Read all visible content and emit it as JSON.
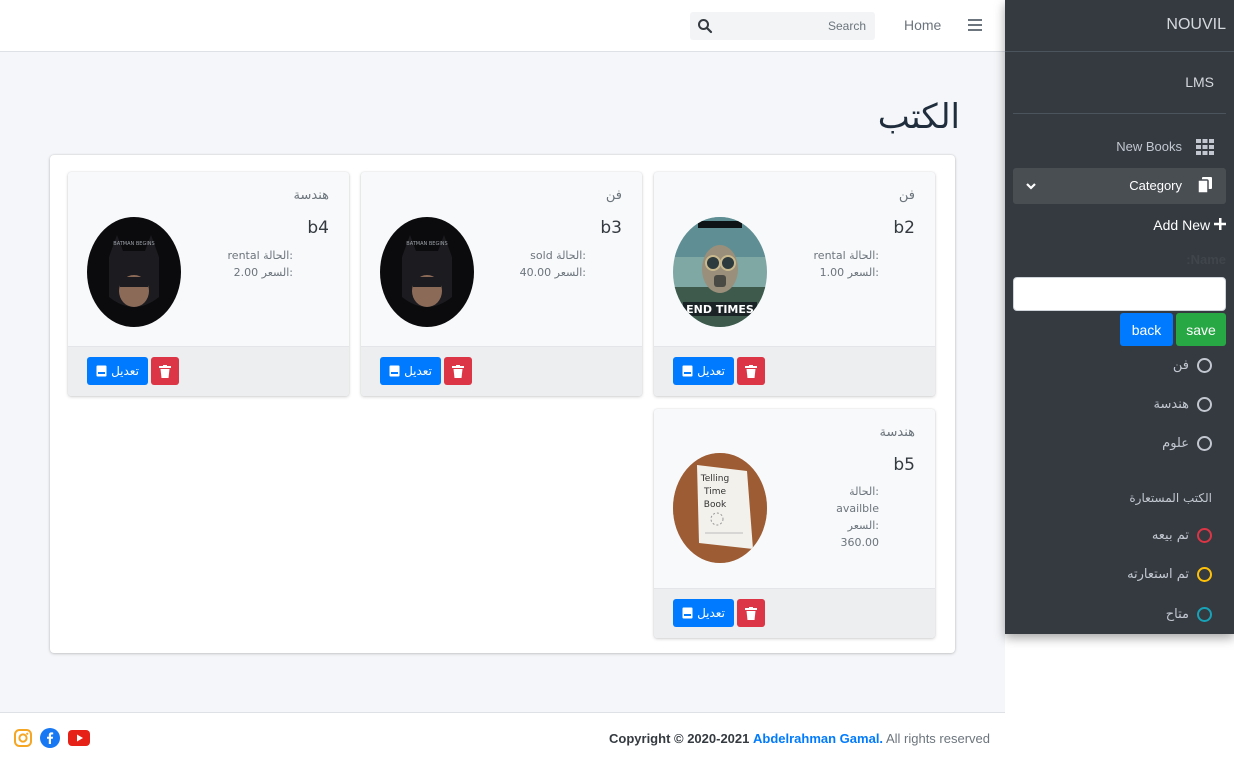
{
  "topbar": {
    "home": "Home",
    "search_placeholder": "Search"
  },
  "main": {
    "title": "الكتب",
    "cards": [
      {
        "category": "فن",
        "name": "b2",
        "status_label": "الحالة:",
        "status": "rental",
        "price_label": "السعر:",
        "price": "1.00",
        "cover": "end-times-cover"
      },
      {
        "category": "فن",
        "name": "b3",
        "status_label": "الحالة:",
        "status": "sold",
        "price_label": "السعر:",
        "price": "40.00",
        "cover": "batman-cover"
      },
      {
        "category": "هندسة",
        "name": "b4",
        "status_label": "الحالة:",
        "status": "rental",
        "price_label": "السعر:",
        "price": "2.00",
        "cover": "batman-cover"
      },
      {
        "category": "هندسة",
        "name": "b5",
        "status_label": "الحالة:",
        "status": "availble",
        "price_label": "السعر:",
        "price": "360.00",
        "cover": "telling-time-book-cover"
      }
    ],
    "edit_label": "تعديل"
  },
  "footer": {
    "copyright_prefix": "Copyright © 2020-2021",
    "author": "Abdelrahman Gamal.",
    "rights": "All rights reserved",
    "social_icons": [
      "instagram-icon",
      "facebook-icon",
      "youtube-icon"
    ]
  },
  "sidebar": {
    "brand": "NOUVIL",
    "user": "LMS",
    "nav": [
      {
        "label": "New Books",
        "icon": "grid-icon"
      },
      {
        "label": "Category",
        "icon": "copy-icon"
      }
    ],
    "add_new": "Add New",
    "name_label": ":Name",
    "save": "save",
    "back": "back",
    "categories": [
      "فن",
      "هندسة",
      "علوم"
    ],
    "borrowed_header": "الكتب المستعارة",
    "statuses": [
      {
        "label": "تم بيعه",
        "color": "#dc3545"
      },
      {
        "label": "تم استعارته",
        "color": "#ffc107"
      },
      {
        "label": "متاح",
        "color": "#17a2b8"
      }
    ]
  },
  "colors": {
    "primary": "#007bff",
    "danger": "#dc3545",
    "success": "#28a745",
    "sidebar_bg": "#343a40"
  }
}
